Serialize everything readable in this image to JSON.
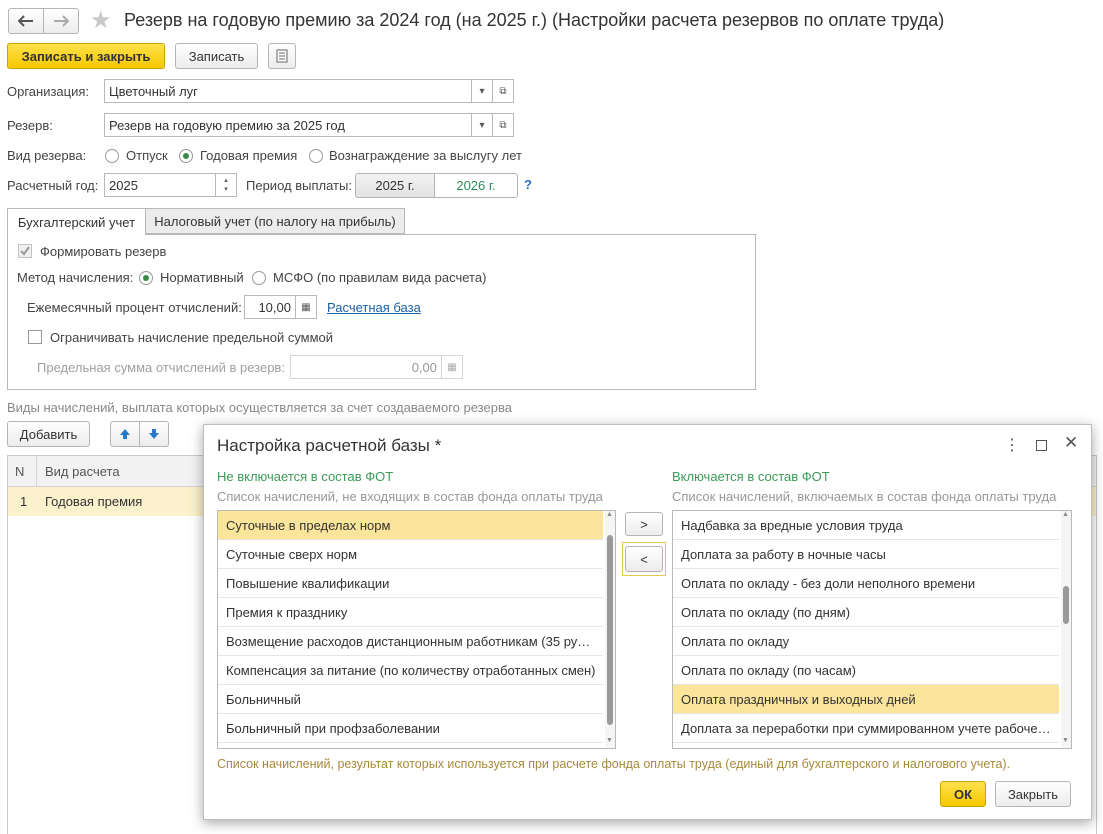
{
  "window": {
    "title": "Резерв на годовую премию за 2024 год (на 2025 г.) (Настройки расчета резервов по оплате труда)"
  },
  "toolbar": {
    "save_close": "Записать и закрыть",
    "save": "Записать"
  },
  "form": {
    "org_label": "Организация:",
    "org_value": "Цветочный луг",
    "reserve_label": "Резерв:",
    "reserve_value": "Резерв на годовую премию за 2025 год",
    "kind_label": "Вид резерва:",
    "kind_options": [
      "Отпуск",
      "Годовая премия",
      "Вознаграждение за выслугу лет"
    ],
    "kind_selected": "Годовая премия",
    "year_label": "Расчетный год:",
    "year_value": "2025",
    "period_label": "Период выплаты:",
    "period_options": [
      "2025 г.",
      "2026 г."
    ],
    "period_selected": "2026 г.",
    "help": "?"
  },
  "tabs": [
    "Бухгалтерский учет",
    "Налоговый учет (по налогу на прибыль)"
  ],
  "accounting": {
    "form_reserve": "Формировать резерв",
    "method_label": "Метод начисления:",
    "method_options": [
      "Нормативный",
      "МСФО (по правилам вида расчета)"
    ],
    "method_selected": "Нормативный",
    "percent_label": "Ежемесячный процент отчислений:",
    "percent_value": "10,00",
    "base_link": "Расчетная база",
    "limit_check": "Ограничивать начисление предельной суммой",
    "limit_label": "Предельная сумма отчислений в резерв:",
    "limit_value": "0,00"
  },
  "accruals": {
    "caption": "Виды начислений, выплата которых осуществляется за счет создаваемого резерва",
    "add": "Добавить",
    "col_n": "N",
    "col_kind": "Вид расчета",
    "rows": [
      {
        "n": "1",
        "kind": "Годовая премия"
      }
    ]
  },
  "dialog": {
    "title": "Настройка расчетной базы *",
    "left_title": "Не включается в состав ФОТ",
    "left_sub": "Список начислений, не входящих в состав фонда оплаты труда",
    "left_items": [
      "Суточные в пределах норм",
      "Суточные сверх норм",
      "Повышение квалификации",
      "Премия к празднику",
      "Возмещение расходов дистанционным работникам (35 ру…",
      "Компенсация за питание (по количеству отработанных смен)",
      "Больничный",
      "Больничный при профзаболевании"
    ],
    "right_title": "Включается в состав ФОТ",
    "right_sub": "Список начислений, включаемых в состав фонда оплаты труда",
    "right_items": [
      "Надбавка за вредные условия труда",
      "Доплата за работу в ночные часы",
      "Оплата по окладу - без доли неполного времени",
      "Оплата по окладу (по дням)",
      "Оплата по окладу",
      "Оплата по окладу (по часам)",
      "Оплата праздничных и выходных дней",
      "Доплата за переработки при суммированном учете рабоче…"
    ],
    "move_right": ">",
    "move_left": "<",
    "footer_note": "Список начислений, результат которых используется при расчете фонда оплаты труда (единый для бухгалтерского и налогового учета).",
    "ok": "ОК",
    "close": "Закрыть"
  }
}
